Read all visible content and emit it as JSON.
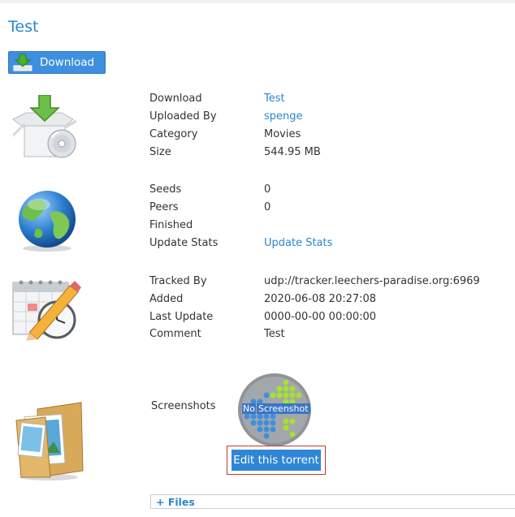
{
  "page": {
    "title": "Test"
  },
  "download_button": {
    "label": "Download"
  },
  "details": {
    "download": {
      "label": "Download",
      "value": "Test"
    },
    "uploaded_by": {
      "label": "Uploaded By",
      "value": "spenge"
    },
    "category": {
      "label": "Category",
      "value": "Movies"
    },
    "size": {
      "label": "Size",
      "value": "544.95 MB"
    }
  },
  "stats": {
    "seeds": {
      "label": "Seeds",
      "value": "0"
    },
    "peers": {
      "label": "Peers",
      "value": "0"
    },
    "finished": {
      "label": "Finished",
      "value": ""
    },
    "update_stats": {
      "label": "Update Stats",
      "value": "Update Stats"
    }
  },
  "tracking": {
    "tracked_by": {
      "label": "Tracked By",
      "value": "udp://tracker.leechers-paradise.org:6969"
    },
    "added": {
      "label": "Added",
      "value": "2020-06-08 20:27:08"
    },
    "last_update": {
      "label": "Last Update",
      "value": "0000-00-00 00:00:00"
    },
    "comment": {
      "label": "Comment",
      "value": "Test"
    }
  },
  "screenshots": {
    "label": "Screenshots",
    "placeholder_no": "No",
    "placeholder_screenshot": "Screenshot"
  },
  "edit_button": {
    "label": "Edit this torrent"
  },
  "files_toggle": {
    "label": "+ Files"
  },
  "colors": {
    "link": "#2a86d1",
    "button": "#3e8fde",
    "highlight_border": "#c0392b"
  }
}
